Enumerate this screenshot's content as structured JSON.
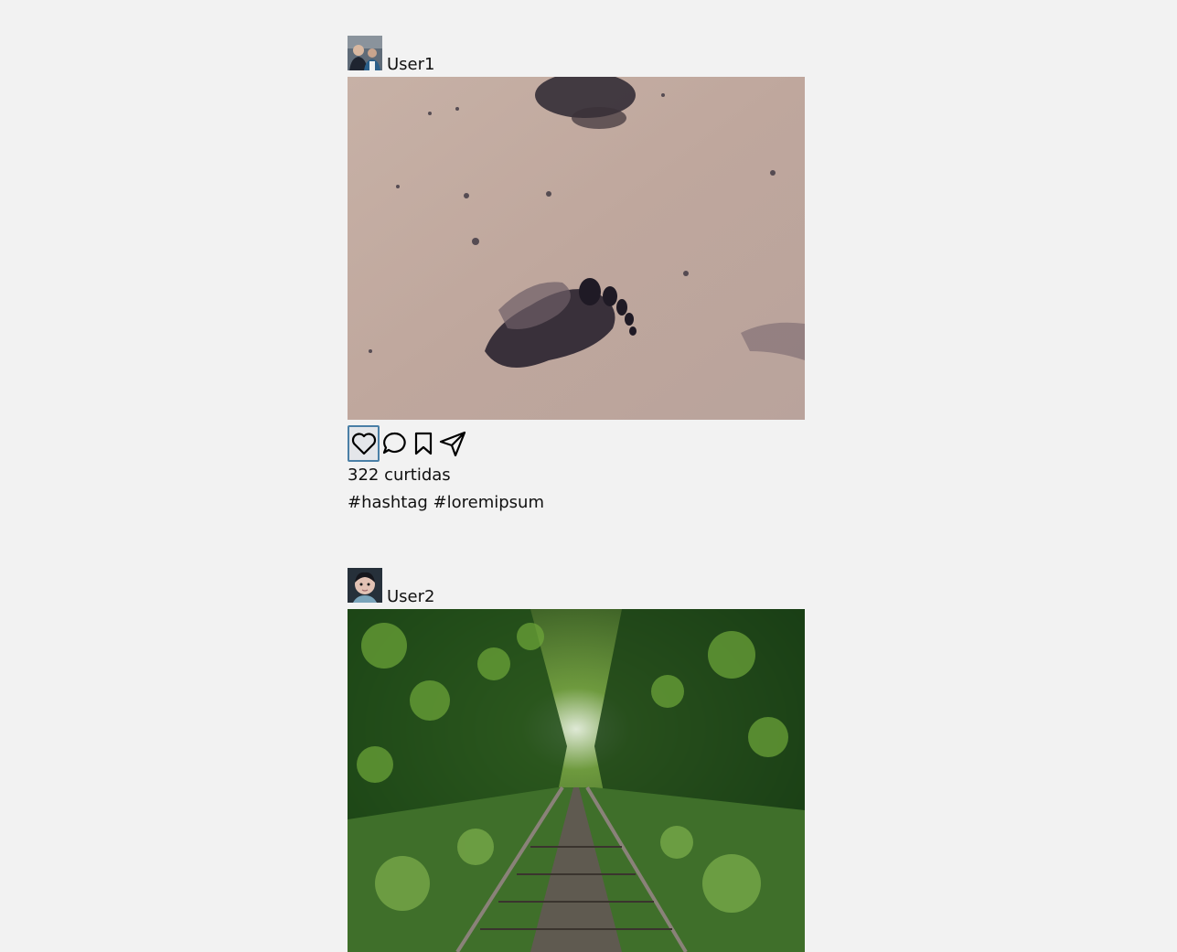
{
  "feed": {
    "posts": [
      {
        "username": "User1",
        "avatar_icon": "person-avatar-photo",
        "photo_description_icon": "footprint-in-sand-photo",
        "likes_label": "322 curtidas",
        "caption": "#hashtag #loremipsum",
        "actions": [
          "heart-icon",
          "comment-icon",
          "bookmark-icon",
          "send-icon"
        ]
      },
      {
        "username": "User2",
        "avatar_icon": "child-avatar-photo",
        "photo_description_icon": "railway-forest-photo"
      }
    ]
  },
  "colors": {
    "background": "#f2f2f2",
    "focus_border": "#4a7fa6"
  }
}
